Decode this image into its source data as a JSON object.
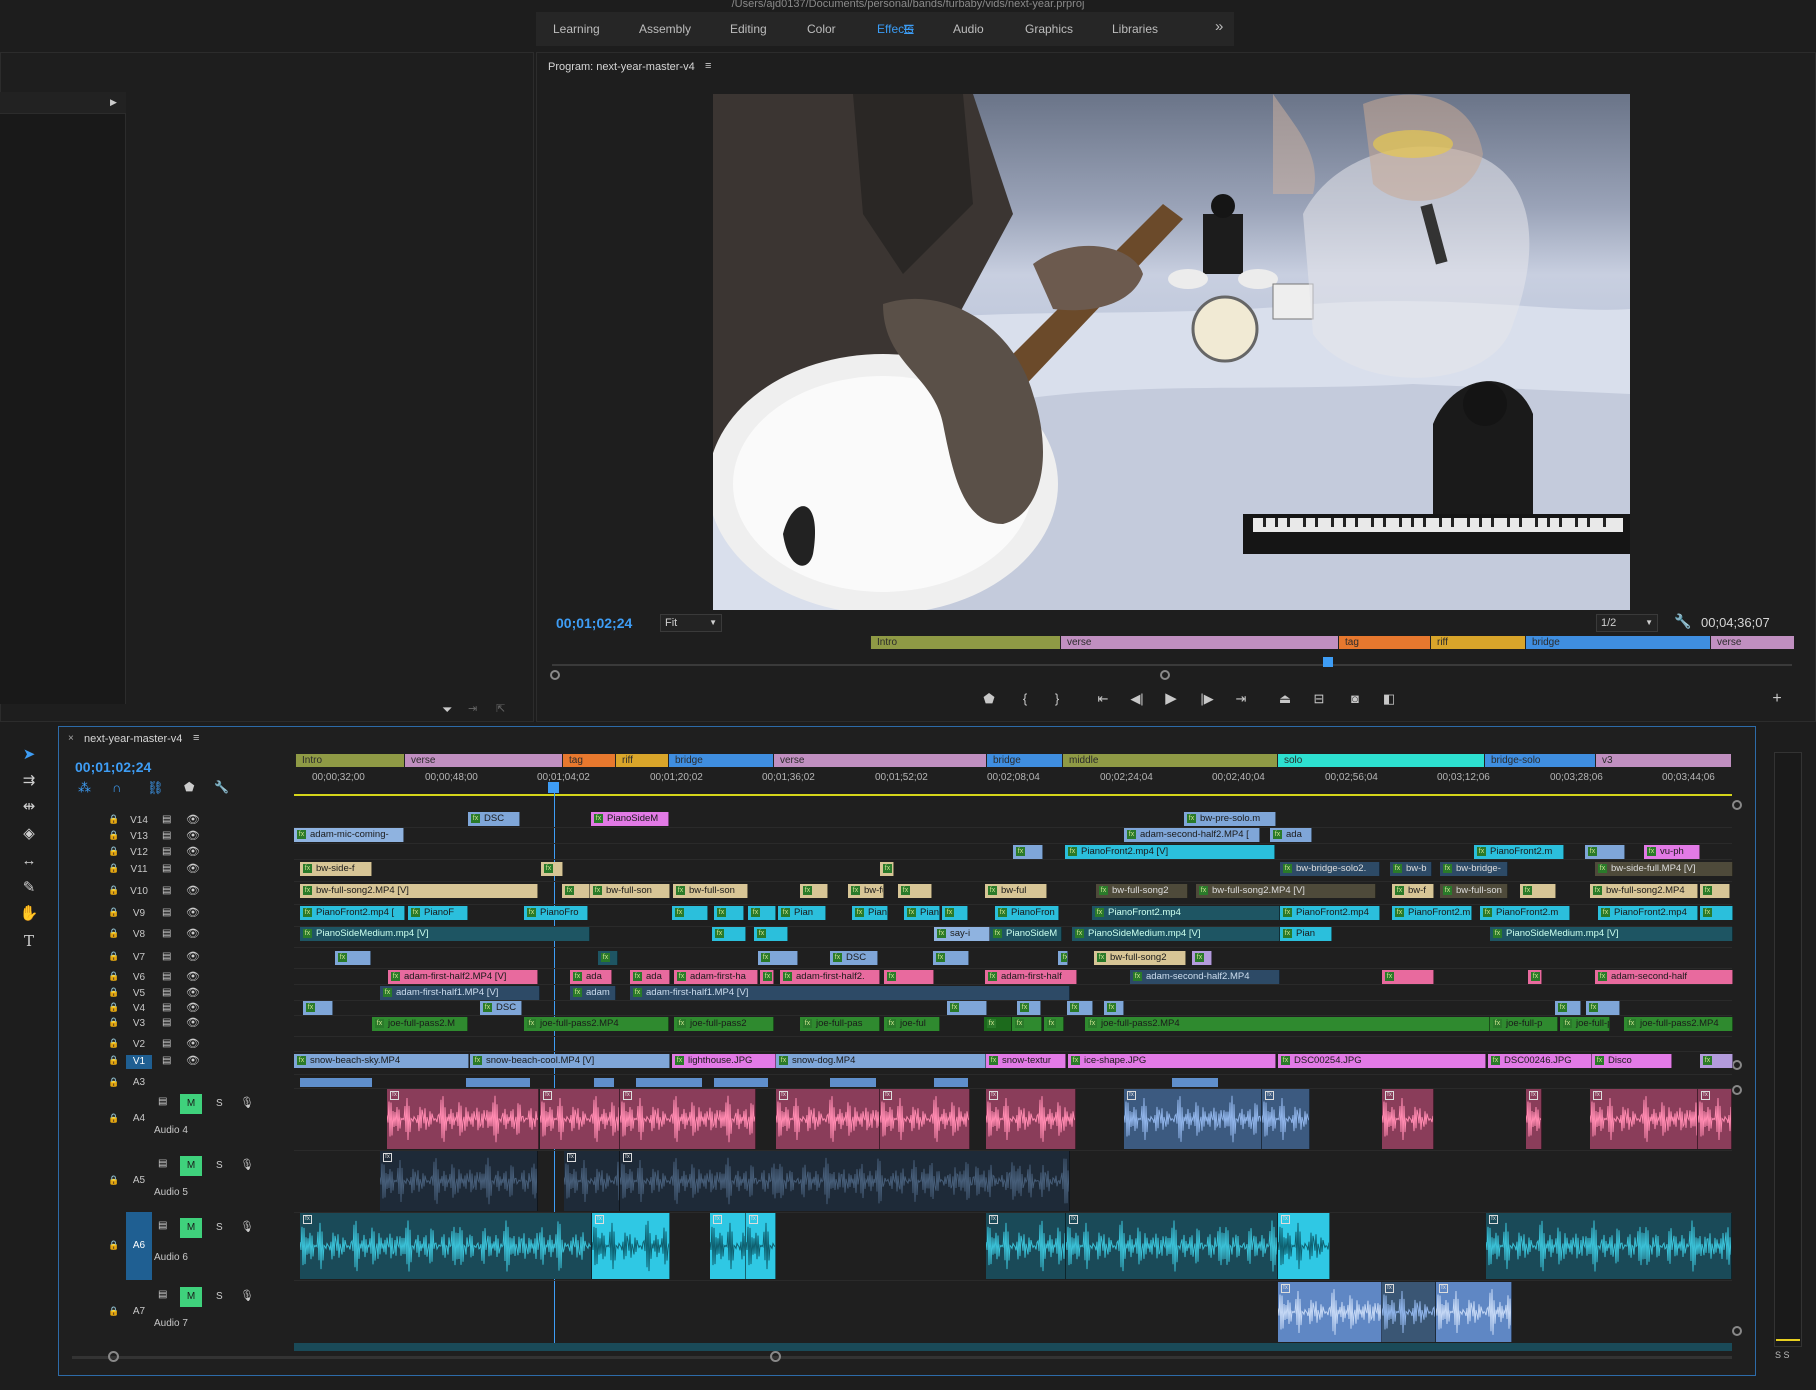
{
  "path": "/Users/ajd0137/Documents/personal/bands/furbaby/vids/next-year.prproj",
  "workspaces": [
    "Learning",
    "Assembly",
    "Editing",
    "Color",
    "Effects",
    "Audio",
    "Graphics",
    "Libraries"
  ],
  "active_workspace": "Effects",
  "program": {
    "title": "Program: next-year-master-v4",
    "timecode": "00;01;02;24",
    "fit": "Fit",
    "quality": "1/2",
    "duration": "00;04;36;07",
    "markers": [
      {
        "label": "Intro",
        "color": "#8f9a45"
      },
      {
        "label": "verse",
        "color": "#c08fc0"
      },
      {
        "label": "tag",
        "color": "#e7782e"
      },
      {
        "label": "riff",
        "color": "#d9a52a"
      },
      {
        "label": "bridge",
        "color": "#3f8ee0"
      },
      {
        "label": "verse",
        "color": "#c08fc0"
      }
    ]
  },
  "timeline": {
    "tab": "next-year-master-v4",
    "timecode": "00;01;02;24",
    "markers": [
      {
        "label": "Intro",
        "color": "#8f9a45"
      },
      {
        "label": "verse",
        "color": "#c08fc0"
      },
      {
        "label": "tag",
        "color": "#e7782e"
      },
      {
        "label": "riff",
        "color": "#d9a52a"
      },
      {
        "label": "bridge",
        "color": "#3f8ee0"
      },
      {
        "label": "verse",
        "color": "#c08fc0"
      },
      {
        "label": "bridge",
        "color": "#3f8ee0"
      },
      {
        "label": "middle",
        "color": "#8f9a45"
      },
      {
        "label": "solo",
        "color": "#2de0d0"
      },
      {
        "label": "bridge-solo",
        "color": "#3f8ee0"
      },
      {
        "label": "v3",
        "color": "#c08fc0"
      }
    ],
    "ticks": [
      "00;00;32;00",
      "00;00;48;00",
      "00;01;04;02",
      "00;01;20;02",
      "00;01;36;02",
      "00;01;52;02",
      "00;02;08;04",
      "00;02;24;04",
      "00;02;40;04",
      "00;02;56;04",
      "00;03;12;06",
      "00;03;28;06",
      "00;03;44;06"
    ],
    "video_tracks": [
      "V14",
      "V13",
      "V12",
      "V11",
      "V10",
      "V9",
      "V8",
      "V7",
      "V6",
      "V5",
      "V4",
      "V3",
      "V2",
      "V1"
    ],
    "audio_tracks": [
      {
        "id": "A3",
        "name": ""
      },
      {
        "id": "A4",
        "name": "Audio 4"
      },
      {
        "id": "A5",
        "name": "Audio 5"
      },
      {
        "id": "A6",
        "name": "Audio 6"
      },
      {
        "id": "A7",
        "name": "Audio 7"
      }
    ],
    "mute_label": "M",
    "solo_label": "S",
    "clips": {
      "v14": [
        "DSC",
        "PianoSideM",
        "bw-pre-solo.m"
      ],
      "v13": [
        "adam-mic-coming-",
        "adam-second-half2.MP4 [",
        "ada"
      ],
      "v12": [
        "PianoFront2.mp4 [V]",
        "PianoFront2.m",
        "vu-ph"
      ],
      "v11": [
        "bw-side-f",
        "bw-bridge-solo2.",
        "bw-b",
        "bw-bridge-",
        "bw-side-full.MP4 [V]"
      ],
      "v10": [
        "bw-full-song2.MP4 [V]",
        "bw-full-son",
        "bw-full-son",
        "bw-fu",
        "bw-ful",
        "bw-full-song2",
        "bw-full-song2.MP4 [V]",
        "bw-f",
        "bw-full-son",
        "bw-full-song2.MP4"
      ],
      "v9": [
        "PianoFront2.mp4 [",
        "PianoF",
        "PianoFro",
        "Pian",
        "Piano",
        "Pian",
        "PianoFron",
        "PianoFront2.mp4",
        "PianoFront2.mp4",
        "PianoFront2.m",
        "PianoFront2.m",
        "PianoFront2.mp4"
      ],
      "v8": [
        "PianoSideMedium.mp4 [V]",
        "say-i",
        "PianoSideM",
        "PianoSideMedium.mp4 [V]",
        "Pian",
        "PianoSideMedium.mp4 [V]"
      ],
      "v7": [
        "DSC",
        "bw-full-song2"
      ],
      "v6": [
        "adam-first-half2.MP4 [V]",
        "ada",
        "ada",
        "adam-first-ha",
        "adam-first-half2.",
        "adam-first-half",
        "adam-second-half2.MP4",
        "adam-second-half"
      ],
      "v5": [
        "adam-first-half1.MP4 [V]",
        "adam",
        "adam-first-half1.MP4 [V]"
      ],
      "v4": [
        "DSC"
      ],
      "v3": [
        "joe-full-pass2.M",
        "joe-full-pass2.MP4",
        "joe-full-pass2",
        "joe-full-pas",
        "joe-ful",
        "joe-full-pass2.MP4",
        "joe-full-p",
        "joe-full-p",
        "joe-full-pass2.MP4"
      ],
      "v1": [
        "snow-beach-sky.MP4",
        "snow-beach-cool.MP4 [V]",
        "lighthouse.JPG",
        "snow-dog.MP4",
        "snow-textur",
        "ice-shape.JPG",
        "DSC00254.JPG",
        "DSC00246.JPG",
        "Disco"
      ]
    }
  },
  "meter_labels": "S  S"
}
